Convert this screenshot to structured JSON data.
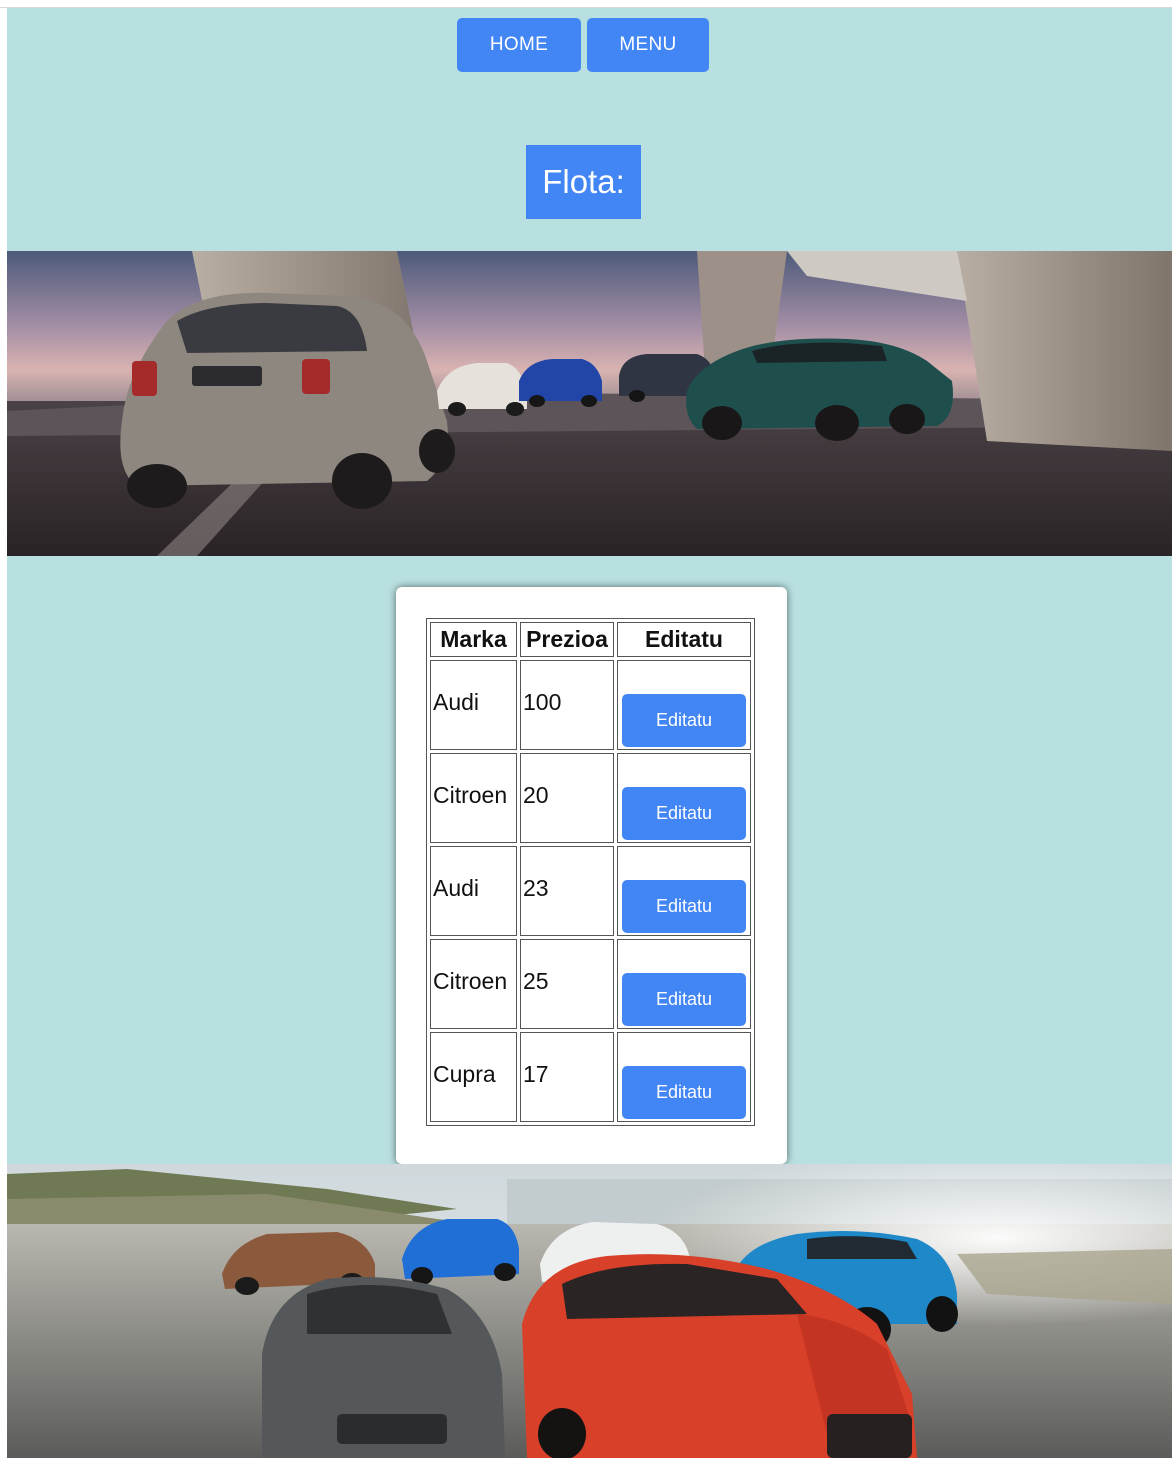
{
  "nav": {
    "home_label": "HOME",
    "menu_label": "MENU"
  },
  "page": {
    "title": "Flota:"
  },
  "table": {
    "headers": [
      "Marka",
      "Prezioa",
      "Editatu"
    ],
    "rows": [
      {
        "marka": "Audi",
        "prezioa": "100",
        "button": "Editatu"
      },
      {
        "marka": "Citroen",
        "prezioa": "20",
        "button": "Editatu"
      },
      {
        "marka": "Audi",
        "prezioa": "23",
        "button": "Editatu"
      },
      {
        "marka": "Citroen",
        "prezioa": "25",
        "button": "Editatu"
      },
      {
        "marka": "Cupra",
        "prezioa": "17",
        "button": "Editatu"
      }
    ]
  },
  "colors": {
    "background": "#b9e0e0",
    "accent": "#4285f4"
  }
}
